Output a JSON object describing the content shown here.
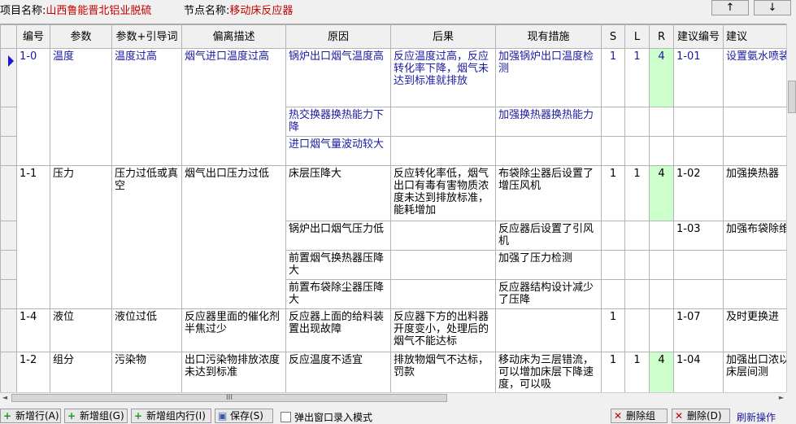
{
  "header": {
    "project_label": "项目名称:",
    "project_name": "山西鲁能晋北铝业脱硫",
    "node_label": "节点名称:",
    "node_name": "移动床反应器",
    "up": "↑",
    "down": "↓"
  },
  "columns": [
    "编号",
    "参数",
    "参数+引导词",
    "偏离描述",
    "原因",
    "后果",
    "现有措施",
    "S",
    "L",
    "R",
    "建议编号",
    "建议"
  ],
  "rows": [
    {
      "id": "1-0",
      "param": "温度",
      "guide": "温度过高",
      "dev": "烟气进口温度过高",
      "cause": "锅炉出口烟气温度高",
      "cons": "反应温度过高，反应转化率下降，烟气未达到标准就排放",
      "meas": "加强锅炉出口温度检测",
      "s": "1",
      "l": "1",
      "r": "4",
      "sid": "1-01",
      "sug": "设置氨水喷装置"
    },
    {
      "cause": "热交换器换热能力下降",
      "meas": "加强换热器换热能力"
    },
    {
      "cause": "进口烟气量波动较大"
    },
    {
      "id": "1-1",
      "param": "压力",
      "guide": "压力过低或真空",
      "dev": "烟气出口压力过低",
      "cause": "床层压降大",
      "cons": "反应转化率低，烟气出口有毒有害物质浓度未达到排放标准，能耗增加",
      "meas": "布袋除尘器后设置了增压风机",
      "s": "1",
      "l": "1",
      "r": "4",
      "sid": "1-02",
      "sug": "加强换热器"
    },
    {
      "cause": "锅炉出口烟气压力低",
      "meas": "反应器后设置了引风机",
      "sid": "1-03",
      "sug": "加强布袋除维护"
    },
    {
      "cause": "前置烟气换热器压降大",
      "meas": "加强了压力检测"
    },
    {
      "cause": "前置布袋除尘器压降大",
      "meas": "反应器结构设计减少了压降"
    },
    {
      "id": "1-4",
      "param": "液位",
      "guide": "液位过低",
      "dev": "反应器里面的催化剂半焦过少",
      "cause": "反应器上面的给料装置出现故障",
      "cons": "反应器下方的出料器开度变小，处理后的烟气不能达标",
      "s": "1",
      "sid": "1-07",
      "sug": "及时更换进"
    },
    {
      "id": "1-2",
      "param": "组分",
      "guide": "污染物",
      "dev": "出口污染物排放浓度未达到标准",
      "cause": "反应温度不适宜",
      "cons": "排放物烟气不达标，罚款",
      "meas": "移动床为三层错流，可以增加床层下降速度，可以吸",
      "s": "1",
      "l": "1",
      "r": "4",
      "sid": "1-04",
      "sug": "加强出口浓以及床层间测"
    }
  ],
  "scroll": {
    "hthumb": "III",
    "left": "◄",
    "right": "►"
  },
  "toolbar": {
    "add_row": "新增行(A)",
    "add_group": "新增组(G)",
    "add_in_group": "新增组内行(I)",
    "save": "保存(S)",
    "popup": "弹出窗口录入模式",
    "del_group": "删除组",
    "del": "删除(D)",
    "refresh": "刷新操作"
  },
  "colors": {
    "accent_red": "#c00000",
    "link_blue": "#1a1aa0",
    "risk_green": "#ccffcc"
  }
}
